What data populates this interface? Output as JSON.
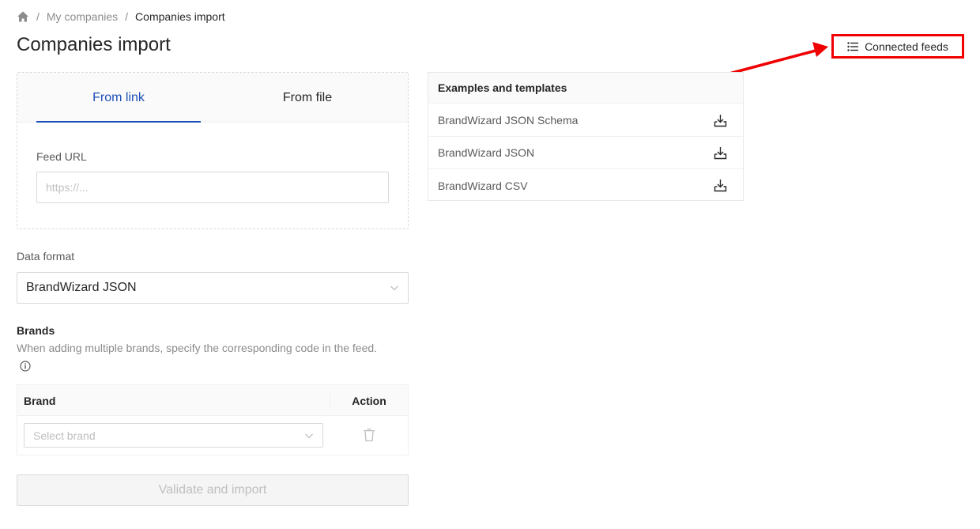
{
  "breadcrumb": {
    "home_icon": "home-icon",
    "separator": "/",
    "items": [
      "My companies",
      "Companies import"
    ]
  },
  "page_title": "Companies import",
  "header_actions": {
    "connected_feeds_label": "Connected feeds",
    "connected_feeds_icon": "list-icon",
    "highlight_color": "#f00000"
  },
  "import": {
    "tabs": [
      {
        "label": "From link",
        "active": true
      },
      {
        "label": "From file",
        "active": false
      }
    ],
    "feed_url_label": "Feed URL",
    "feed_url_placeholder": "https://...",
    "feed_url_value": ""
  },
  "data_format": {
    "label": "Data format",
    "selected": "BrandWizard JSON"
  },
  "brands": {
    "title": "Brands",
    "description": "When adding multiple brands, specify the corresponding code in the feed.",
    "info_icon": "info-icon",
    "table": {
      "columns": [
        "Brand",
        "Action"
      ],
      "rows": [
        {
          "brand_placeholder": "Select brand",
          "action_icon": "trash-icon"
        }
      ]
    }
  },
  "validate_button": "Validate and import",
  "examples": {
    "title": "Examples and templates",
    "items": [
      {
        "label": "BrandWizard JSON Schema",
        "icon": "download-icon"
      },
      {
        "label": "BrandWizard JSON",
        "icon": "download-icon"
      },
      {
        "label": "BrandWizard CSV",
        "icon": "download-icon"
      }
    ]
  },
  "colors": {
    "accent": "#1c4fb8",
    "annotation": "#f00000"
  }
}
